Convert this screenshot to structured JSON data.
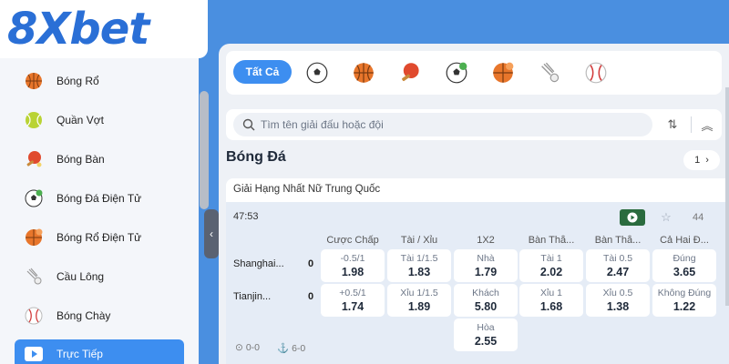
{
  "brand": {
    "logo_text": "8Xbet"
  },
  "sidebar": {
    "items": [
      {
        "label": "Bóng Rổ",
        "icon": "basketball-icon"
      },
      {
        "label": "Quần Vợt",
        "icon": "tennis-ball-icon"
      },
      {
        "label": "Bóng Bàn",
        "icon": "table-tennis-icon"
      },
      {
        "label": "Bóng Đá Điện Tử",
        "icon": "esoccer-icon"
      },
      {
        "label": "Bóng Rổ Điện Tử",
        "icon": "ebasketball-icon"
      },
      {
        "label": "Cầu Lông",
        "icon": "shuttlecock-icon"
      },
      {
        "label": "Bóng Chày",
        "icon": "baseball-icon"
      },
      {
        "label": "Trực Tiếp",
        "icon": "live-play-icon",
        "active": true
      }
    ]
  },
  "sports_bar": {
    "all_label": "Tất Cả",
    "icons": [
      "soccer-ball-icon",
      "basketball-icon",
      "table-tennis-icon",
      "esoccer-icon",
      "ebasketball-icon",
      "shuttlecock-icon",
      "baseball-icon"
    ]
  },
  "search": {
    "placeholder": "Tìm tên giải đấu hoặc đội"
  },
  "section": {
    "title": "Bóng Đá",
    "page": "1"
  },
  "league": {
    "name": "Giải Hạng Nhất Nữ Trung Quốc",
    "match": {
      "time": "47:53",
      "more_markets": "44",
      "columns": [
        "Cược Chấp",
        "Tài / Xỉu",
        "1X2",
        "Bàn Thắ...",
        "Bàn Thắ...",
        "Cả Hai Đ..."
      ],
      "teams": [
        {
          "name": "Shanghai...",
          "score": "0"
        },
        {
          "name": "Tianjin...",
          "score": "0"
        }
      ],
      "odds_row1": [
        {
          "label": "-0.5/1",
          "value": "1.98"
        },
        {
          "label": "Tài 1/1.5",
          "value": "1.83"
        },
        {
          "label": "Nhà",
          "value": "1.79"
        },
        {
          "label": "Tài 1",
          "value": "2.02"
        },
        {
          "label": "Tài 0.5",
          "value": "2.47"
        },
        {
          "label": "Đúng",
          "value": "3.65"
        }
      ],
      "odds_row2": [
        {
          "label": "+0.5/1",
          "value": "1.74"
        },
        {
          "label": "Xỉu 1/1.5",
          "value": "1.89"
        },
        {
          "label": "Khách",
          "value": "5.80"
        },
        {
          "label": "Xỉu 1",
          "value": "1.68"
        },
        {
          "label": "Xỉu 0.5",
          "value": "1.38"
        },
        {
          "label": "Không Đúng",
          "value": "1.22"
        }
      ],
      "draw": {
        "label": "Hòa",
        "value": "2.55"
      },
      "footer": {
        "corners": "0-0",
        "other": "6-0"
      }
    }
  }
}
